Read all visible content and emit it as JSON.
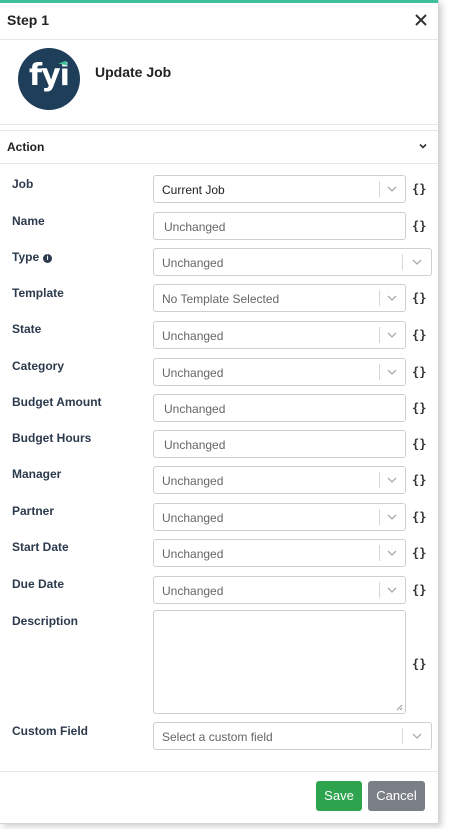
{
  "dialog": {
    "step_title": "Step 1",
    "close_icon": "close-icon",
    "logo_text": "fyi",
    "action_title": "Update Job",
    "section_label": "Action",
    "accent_color": "#3fbf9b",
    "logo_color": "#1f3e5a"
  },
  "fields": {
    "job": {
      "label": "Job",
      "value": "Current Job"
    },
    "name": {
      "label": "Name",
      "placeholder": "Unchanged"
    },
    "type": {
      "label": "Type",
      "value": "Unchanged"
    },
    "template": {
      "label": "Template",
      "value": "No Template Selected"
    },
    "state": {
      "label": "State",
      "value": "Unchanged"
    },
    "category": {
      "label": "Category",
      "value": "Unchanged"
    },
    "budget_amount": {
      "label": "Budget Amount",
      "placeholder": "Unchanged"
    },
    "budget_hours": {
      "label": "Budget Hours",
      "placeholder": "Unchanged"
    },
    "manager": {
      "label": "Manager",
      "value": "Unchanged"
    },
    "partner": {
      "label": "Partner",
      "value": "Unchanged"
    },
    "start_date": {
      "label": "Start Date",
      "value": "Unchanged"
    },
    "due_date": {
      "label": "Due Date",
      "value": "Unchanged"
    },
    "description": {
      "label": "Description",
      "value": ""
    },
    "custom_field": {
      "label": "Custom Field",
      "value": "Select a custom field"
    }
  },
  "footer": {
    "save_label": "Save",
    "cancel_label": "Cancel",
    "save_color": "#2ea44f",
    "cancel_color": "#7b8088"
  },
  "icons": {
    "variable": "{}",
    "info": "i"
  }
}
